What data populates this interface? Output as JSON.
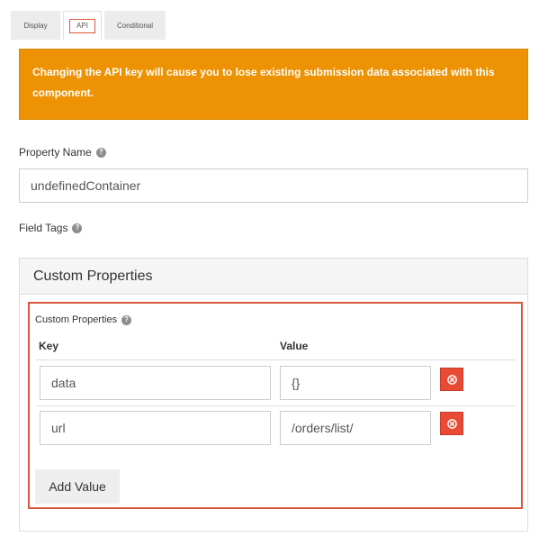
{
  "tabs": [
    {
      "label": "Display"
    },
    {
      "label": "API"
    },
    {
      "label": "Conditional"
    }
  ],
  "alert": {
    "text": "Changing the API key will cause you to lose existing submission data associated with this component."
  },
  "property_name": {
    "label": "Property Name",
    "value": "undefinedContainer"
  },
  "field_tags": {
    "label": "Field Tags"
  },
  "panel": {
    "title": "Custom Properties",
    "datagrid": {
      "label": "Custom Properties",
      "headers": {
        "key": "Key",
        "value": "Value"
      },
      "rows": [
        {
          "key": "data",
          "value": "{}"
        },
        {
          "key": "url",
          "value": "/orders/list/"
        }
      ],
      "add_label": "Add Value"
    }
  },
  "colors": {
    "alert": "#ec9203",
    "highlight": "#d9573b",
    "delete": "#e94a35"
  },
  "icons": {
    "help": "question-circle-icon",
    "remove": "remove-circle-icon"
  }
}
